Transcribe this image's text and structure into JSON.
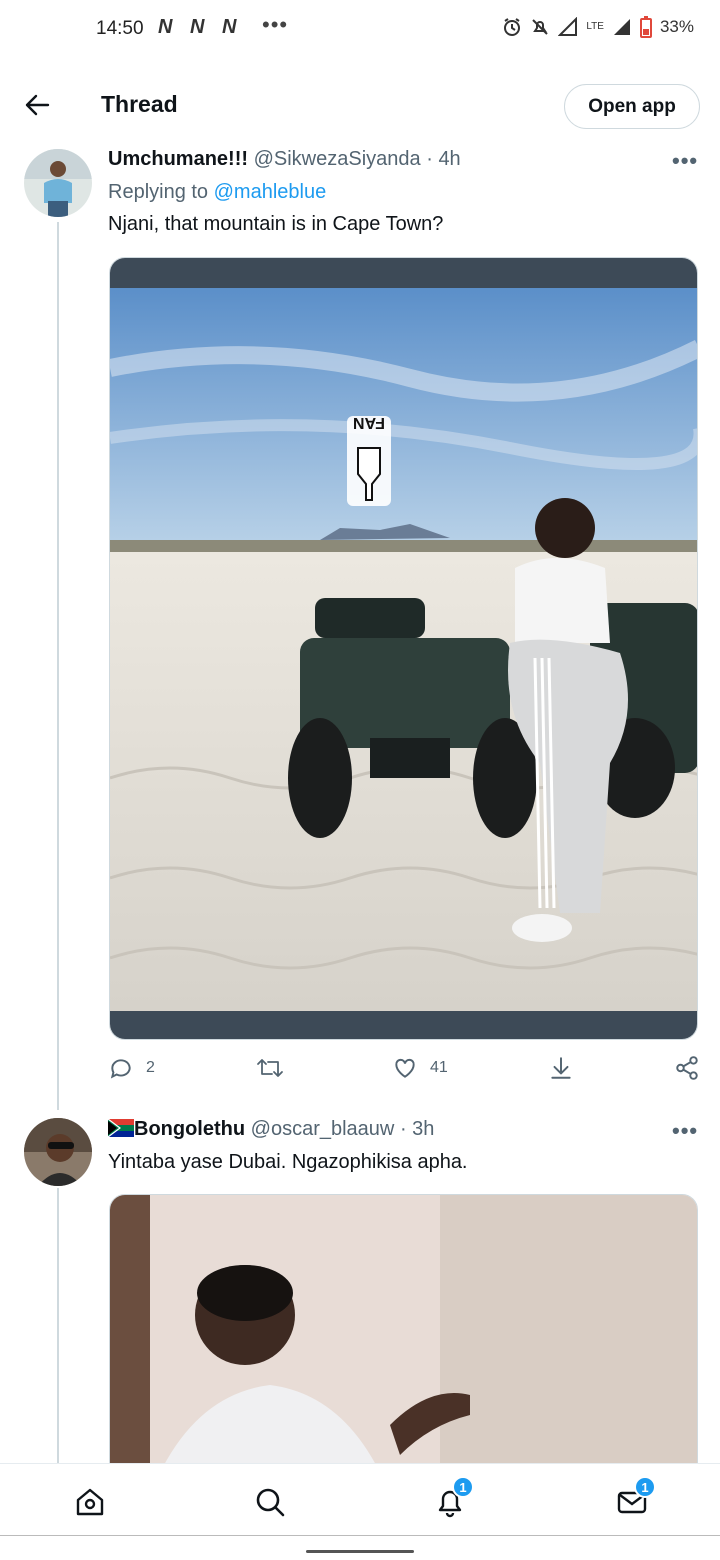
{
  "status_bar": {
    "time": "14:50",
    "notification_icons": [
      "N",
      "N",
      "N"
    ],
    "more": "•••",
    "network": "LTE",
    "battery": "33%"
  },
  "header": {
    "back_icon": "arrow-left-icon",
    "title": "Thread",
    "open_app_label": "Open app"
  },
  "tweets": [
    {
      "name": "Umchumane!!!",
      "handle": "@SikwezaSiyanda",
      "separator": "·",
      "time": "4h",
      "replying_prefix": "Replying to",
      "replying_to": "@mahleblue",
      "text": "Njani, that mountain is in Cape Town?",
      "media_overlay_text": "FAN",
      "actions": {
        "replies": "2",
        "retweets": "",
        "likes": "41"
      }
    },
    {
      "name": "Bongolethu",
      "handle": "@oscar_blaauw",
      "separator": "·",
      "time": "3h",
      "text": "Yintaba yase Dubai. Ngazophikisa apha."
    }
  ],
  "bottom_nav": {
    "items": [
      "home-icon",
      "search-icon",
      "notifications-icon",
      "messages-icon"
    ],
    "notifications_badge": "1",
    "messages_badge": "1"
  },
  "colors": {
    "accent": "#1d9bf0",
    "text": "#0f1419",
    "secondary_text": "#536471",
    "border": "#cfd9de"
  }
}
